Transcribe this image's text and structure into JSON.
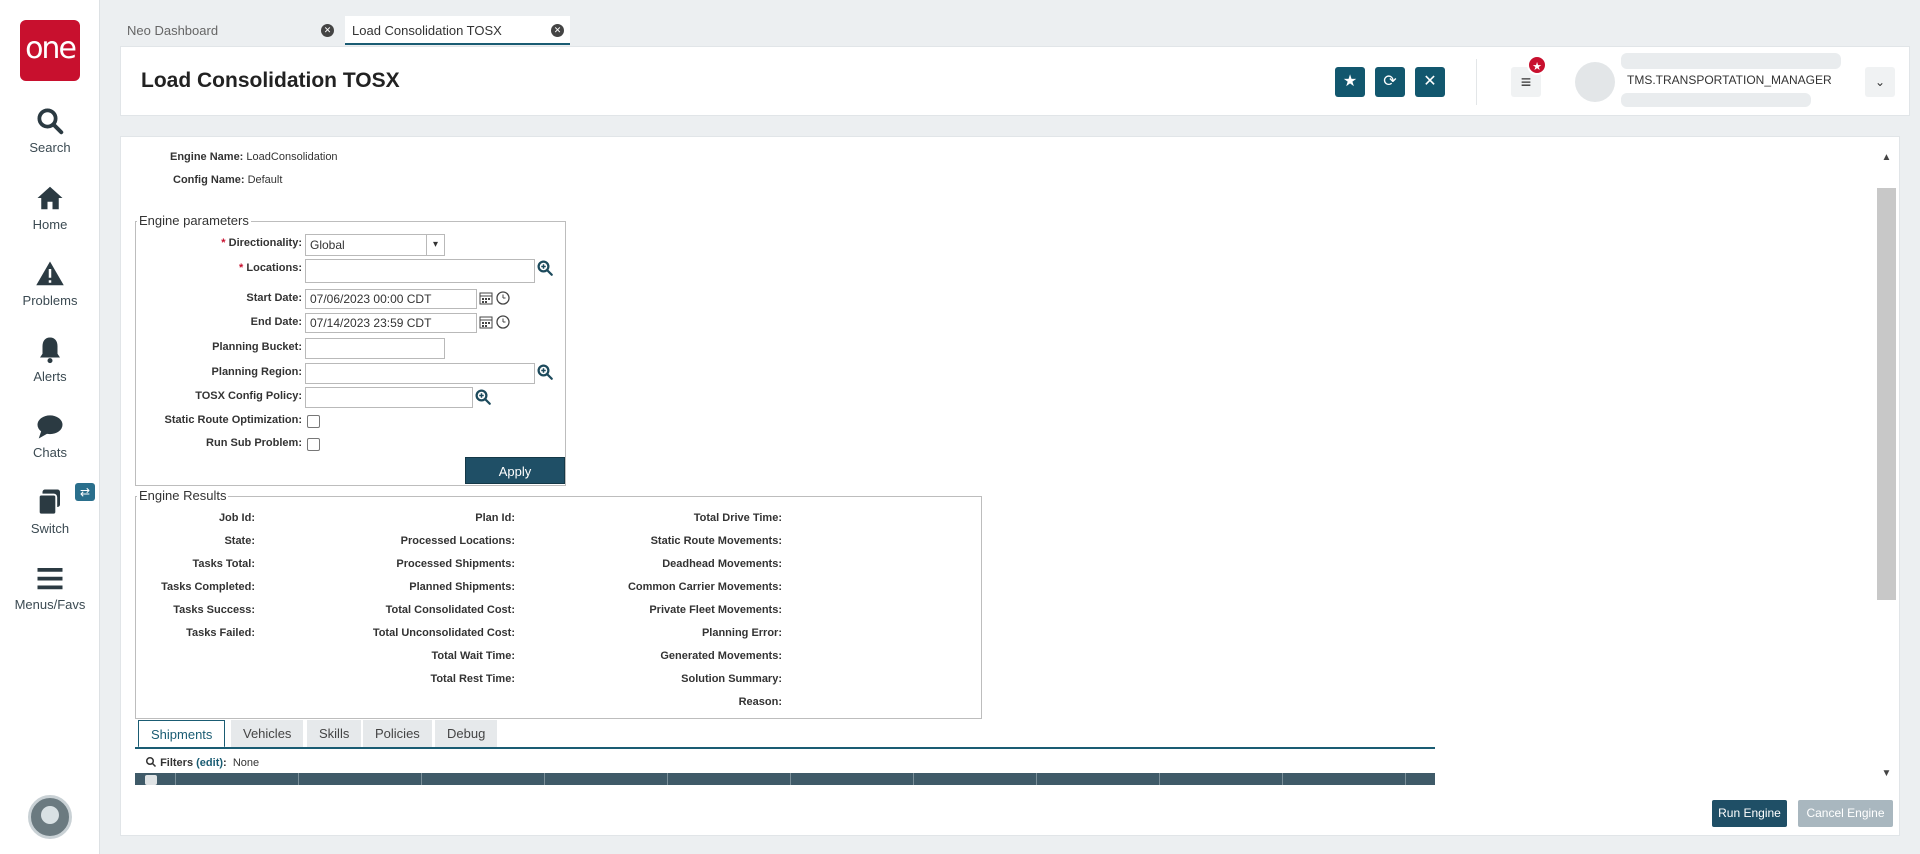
{
  "app": {
    "logo_text": "one"
  },
  "nav": {
    "items": [
      {
        "label": "Search",
        "icon": "search-icon"
      },
      {
        "label": "Home",
        "icon": "home-icon"
      },
      {
        "label": "Problems",
        "icon": "warning-icon"
      },
      {
        "label": "Alerts",
        "icon": "bell-icon"
      },
      {
        "label": "Chats",
        "icon": "chat-icon"
      },
      {
        "label": "Switch",
        "icon": "switch-icon"
      },
      {
        "label": "Menus/Favs",
        "icon": "hamburger-icon"
      }
    ]
  },
  "tabs": [
    {
      "label": "Neo Dashboard",
      "active": false
    },
    {
      "label": "Load Consolidation TOSX",
      "active": true
    }
  ],
  "header": {
    "title": "Load Consolidation TOSX",
    "role": "TMS.TRANSPORTATION_MANAGER"
  },
  "info": {
    "engine_name_label": "Engine Name:",
    "engine_name": "LoadConsolidation",
    "config_name_label": "Config Name:",
    "config_name": "Default"
  },
  "params": {
    "legend": "Engine parameters",
    "directionality_label": "Directionality:",
    "directionality_value": "Global",
    "locations_label": "Locations:",
    "start_date_label": "Start Date:",
    "start_date_value": "07/06/2023 00:00 CDT",
    "end_date_label": "End Date:",
    "end_date_value": "07/14/2023 23:59 CDT",
    "planning_bucket_label": "Planning Bucket:",
    "planning_region_label": "Planning Region:",
    "tosx_policy_label": "TOSX Config Policy:",
    "static_route_label": "Static Route Optimization:",
    "run_sub_label": "Run Sub Problem:",
    "apply_label": "Apply"
  },
  "results": {
    "legend": "Engine Results",
    "col1": [
      "Job Id:",
      "State:",
      "Tasks Total:",
      "Tasks Completed:",
      "Tasks Success:",
      "Tasks Failed:"
    ],
    "col2": [
      "Plan Id:",
      "Processed Locations:",
      "Processed Shipments:",
      "Planned Shipments:",
      "Total Consolidated Cost:",
      "Total Unconsolidated Cost:",
      "Total Wait Time:",
      "Total Rest Time:"
    ],
    "col3": [
      "Total Drive Time:",
      "Static Route Movements:",
      "Deadhead Movements:",
      "Common Carrier Movements:",
      "Private Fleet Movements:",
      "Planning Error:",
      "Generated Movements:",
      "Solution Summary:",
      "Reason:"
    ]
  },
  "bottom_tabs": [
    "Shipments",
    "Vehicles",
    "Skills",
    "Policies",
    "Debug"
  ],
  "filters": {
    "label": "Filters",
    "edit": "(edit)",
    "value": "None"
  },
  "footer": {
    "run_label": "Run Engine",
    "cancel_label": "Cancel Engine"
  },
  "colors": {
    "brand_red": "#c8102e",
    "primary_teal": "#12576e"
  }
}
